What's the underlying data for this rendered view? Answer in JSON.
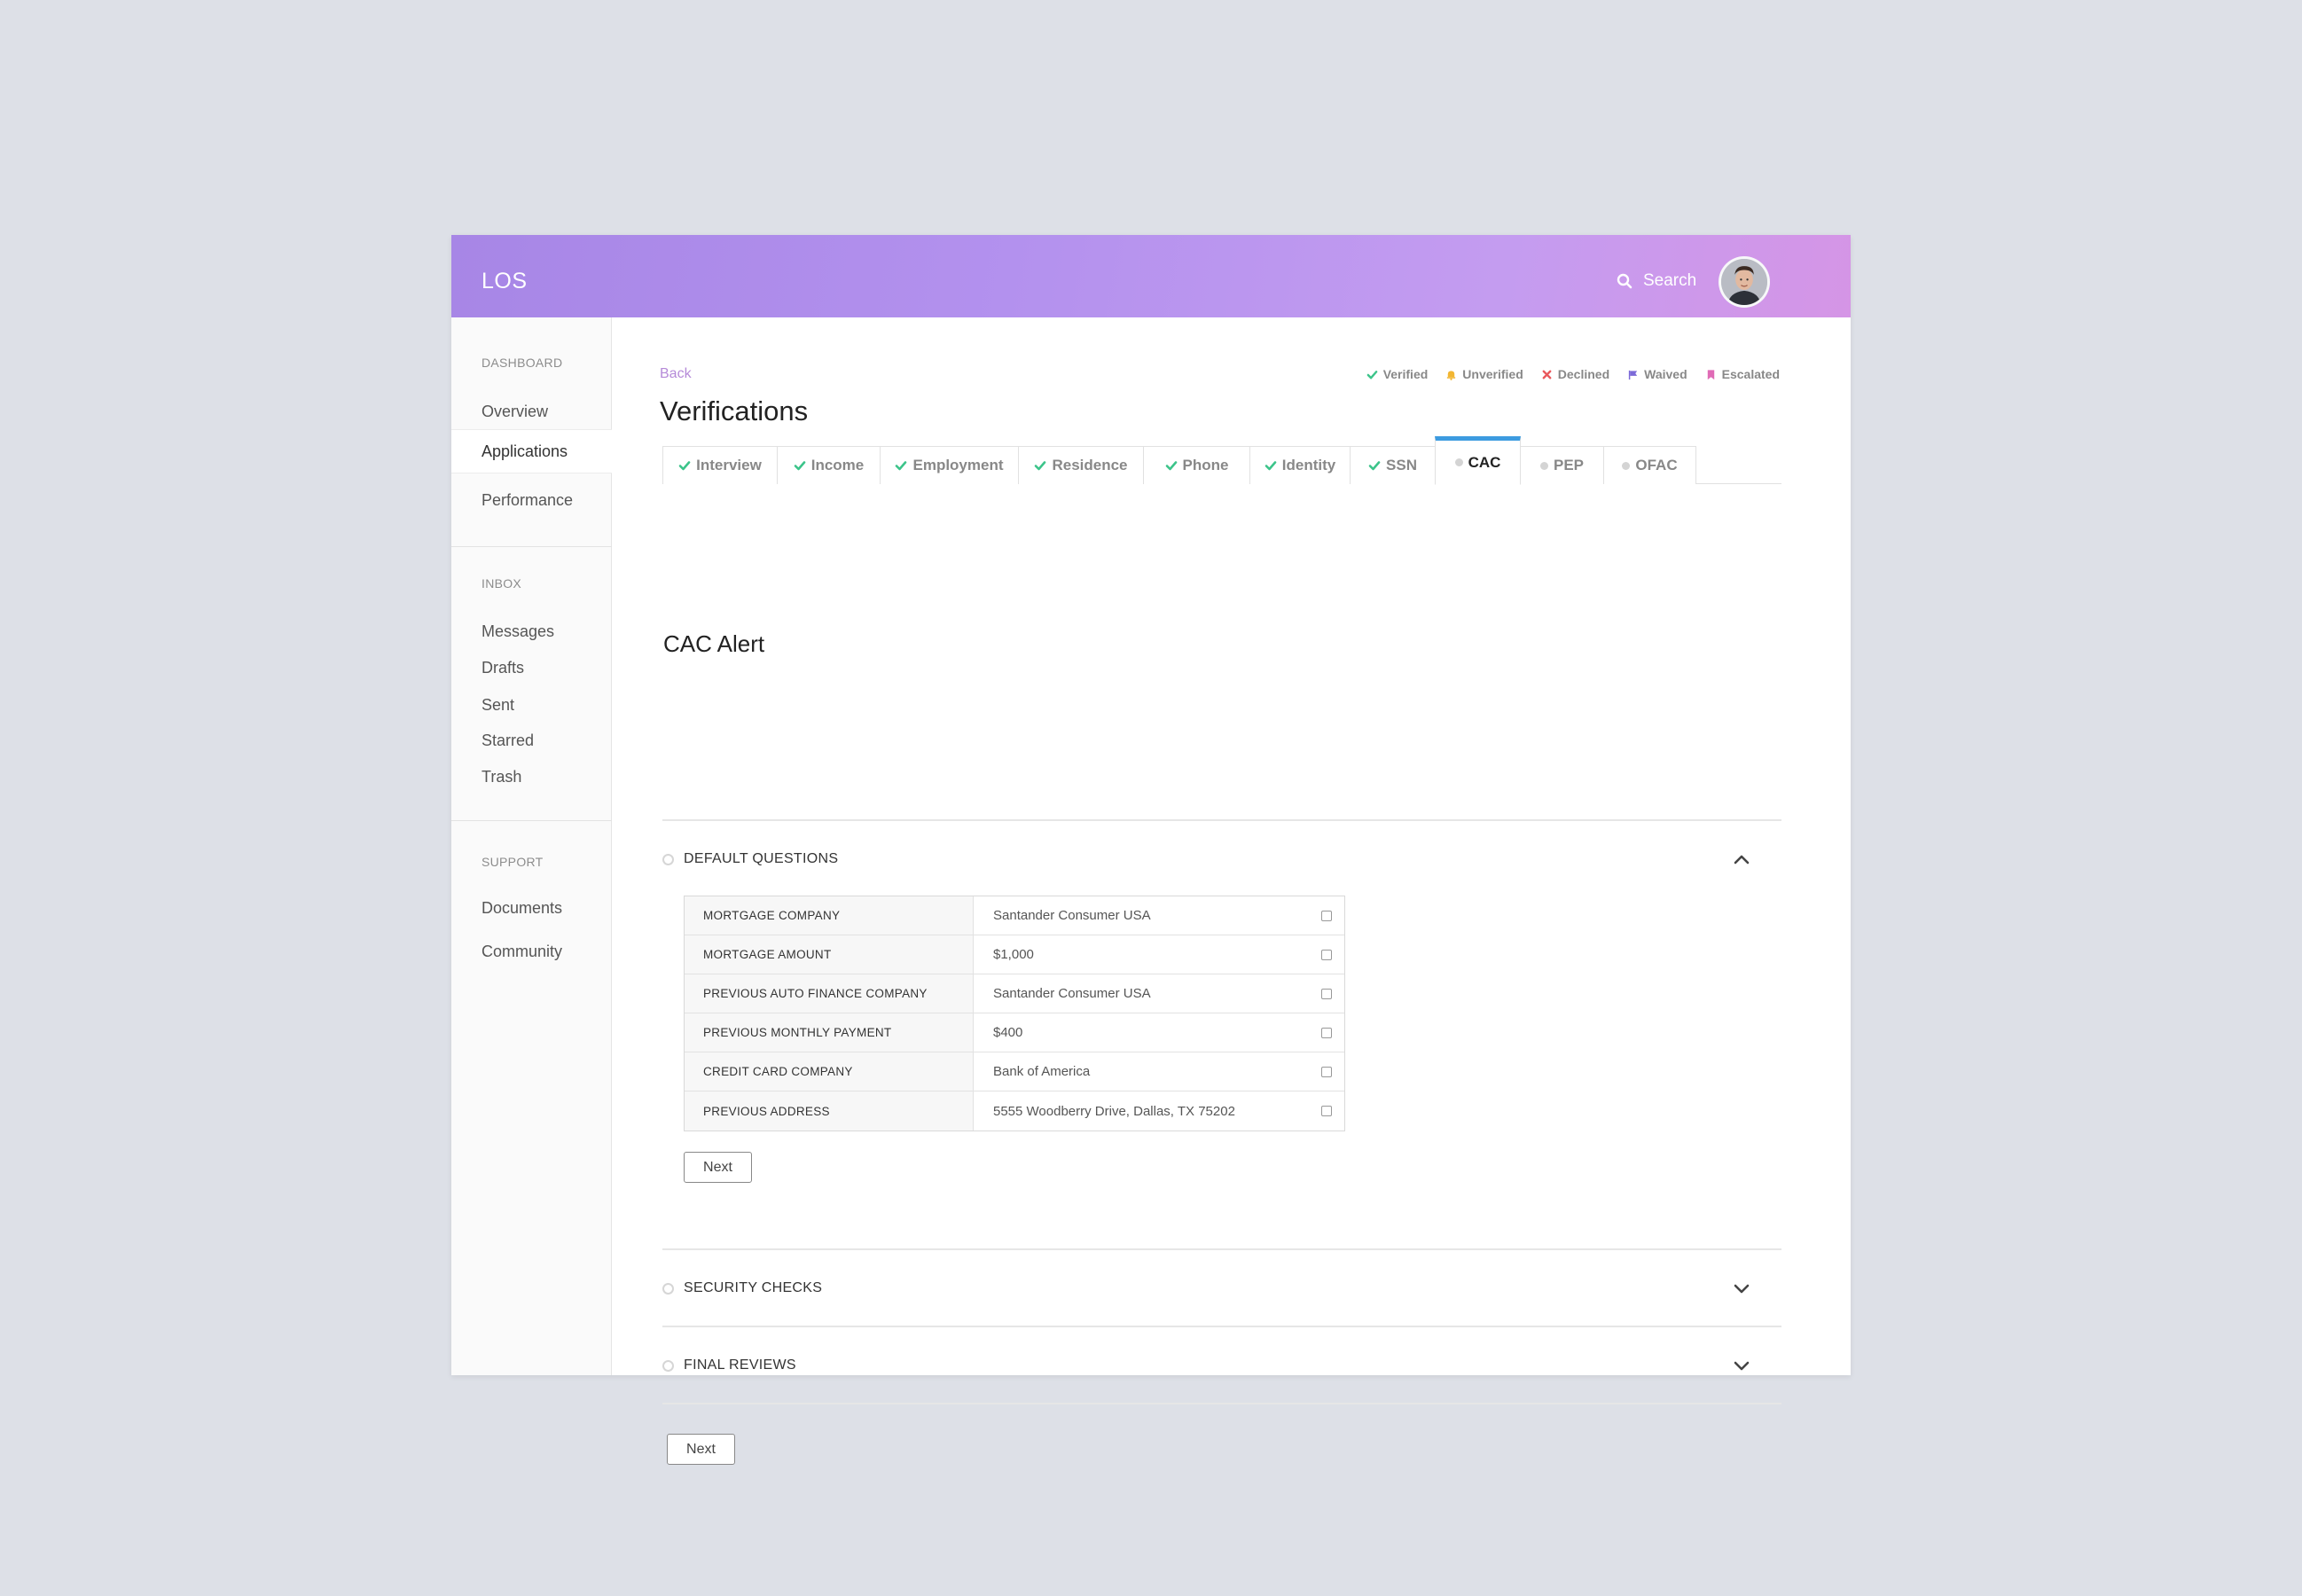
{
  "header": {
    "logo": "LOS",
    "search_label": "Search",
    "search_icon": "search-icon",
    "avatar_icon": "user-avatar"
  },
  "sidebar": {
    "sections": [
      {
        "heading": "DASHBOARD",
        "items": [
          "Overview",
          "Applications",
          "Performance"
        ]
      },
      {
        "heading": "INBOX",
        "items": [
          "Messages",
          "Drafts",
          "Sent",
          "Starred",
          "Trash"
        ]
      },
      {
        "heading": "SUPPORT",
        "items": [
          "Documents",
          "Community"
        ]
      }
    ],
    "active_item": "Applications"
  },
  "main": {
    "back_label": "Back",
    "title": "Verifications",
    "legend": [
      {
        "label": "Verified",
        "icon": "check-icon",
        "color": "#3cc48a"
      },
      {
        "label": "Unverified",
        "icon": "bell-icon",
        "color": "#f2b632"
      },
      {
        "label": "Declined",
        "icon": "x-icon",
        "color": "#e9595d"
      },
      {
        "label": "Waived",
        "icon": "flag-icon",
        "color": "#7c6ad8"
      },
      {
        "label": "Escalated",
        "icon": "bookmark-icon",
        "color": "#e06bb6"
      }
    ],
    "tabs": [
      {
        "label": "Interview",
        "status": "verified"
      },
      {
        "label": "Income",
        "status": "verified"
      },
      {
        "label": "Employment",
        "status": "verified"
      },
      {
        "label": "Residence",
        "status": "verified"
      },
      {
        "label": "Phone",
        "status": "verified"
      },
      {
        "label": "Identity",
        "status": "verified"
      },
      {
        "label": "SSN",
        "status": "verified"
      },
      {
        "label": "CAC",
        "status": "pending",
        "active": true
      },
      {
        "label": "PEP",
        "status": "pending"
      },
      {
        "label": "OFAC",
        "status": "pending"
      }
    ],
    "section_title": "CAC Alert",
    "accordions": [
      {
        "label": "DEFAULT QUESTIONS",
        "expanded": true,
        "rows": [
          {
            "label": "MORTGAGE COMPANY",
            "value": "Santander Consumer USA"
          },
          {
            "label": "MORTGAGE AMOUNT",
            "value": "$1,000"
          },
          {
            "label": "PREVIOUS AUTO FINANCE COMPANY",
            "value": "Santander Consumer USA"
          },
          {
            "label": "PREVIOUS MONTHLY PAYMENT",
            "value": "$400"
          },
          {
            "label": "CREDIT CARD COMPANY",
            "value": "Bank of America"
          },
          {
            "label": "PREVIOUS ADDRESS",
            "value": "5555 Woodberry Drive, Dallas, TX 75202"
          }
        ],
        "next_label": "Next"
      },
      {
        "label": "SECURITY CHECKS",
        "expanded": false
      },
      {
        "label": "FINAL REVIEWS",
        "expanded": false
      }
    ],
    "next_label": "Next"
  },
  "colors": {
    "header_gradient_start": "#a786e6",
    "header_gradient_end": "#d595e6",
    "active_tab_accent": "#3c9be0",
    "back_link": "#b58ad8"
  }
}
